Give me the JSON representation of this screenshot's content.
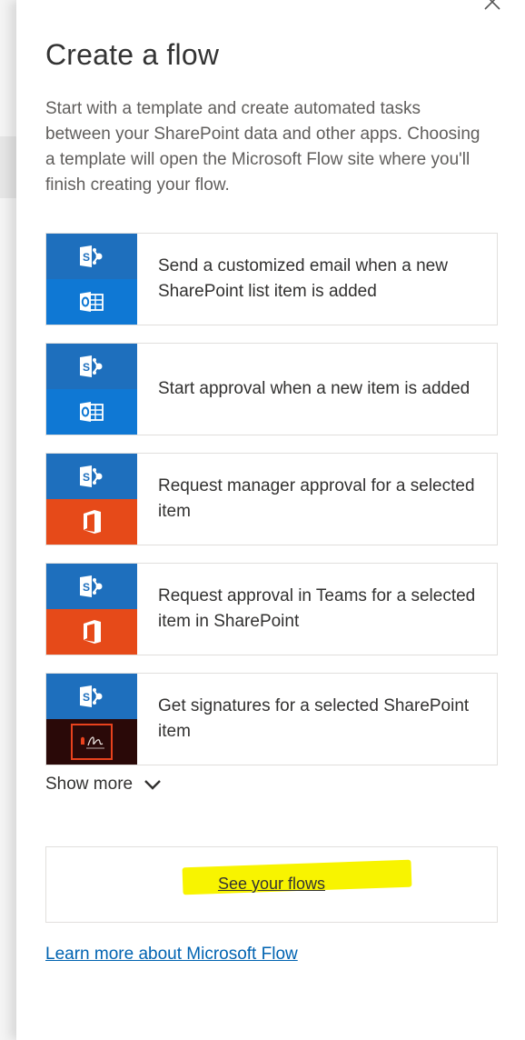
{
  "panel": {
    "title": "Create a flow",
    "description": "Start with a template and create automated tasks between your SharePoint data and other apps. Choosing a template will open the Microsoft Flow site where you'll finish creating your flow."
  },
  "templates": [
    {
      "label": "Send a customized email when a new SharePoint list item is added",
      "icons": [
        "sharepoint-icon",
        "outlook-icon"
      ]
    },
    {
      "label": "Start approval when a new item is added",
      "icons": [
        "sharepoint-icon",
        "outlook-icon"
      ]
    },
    {
      "label": "Request manager approval for a selected item",
      "icons": [
        "sharepoint-icon",
        "office-icon"
      ]
    },
    {
      "label": "Request approval in Teams for a selected item in SharePoint",
      "icons": [
        "sharepoint-icon",
        "office-icon"
      ]
    },
    {
      "label": "Get signatures for a selected SharePoint item",
      "icons": [
        "sharepoint-icon",
        "adobe-sign-icon"
      ]
    }
  ],
  "show_more": {
    "label": "Show more",
    "icon": "chevron-down-icon"
  },
  "see_flows": {
    "label": "See your flows",
    "highlight_color": "#f8f400"
  },
  "learn_more": {
    "label": "Learn more about Microsoft Flow"
  },
  "colors": {
    "sharepoint": "#1e6fbd",
    "outlook": "#0f78d4",
    "office": "#e64a19",
    "adobe_sign": "#2a0908",
    "link": "#0063b1"
  }
}
